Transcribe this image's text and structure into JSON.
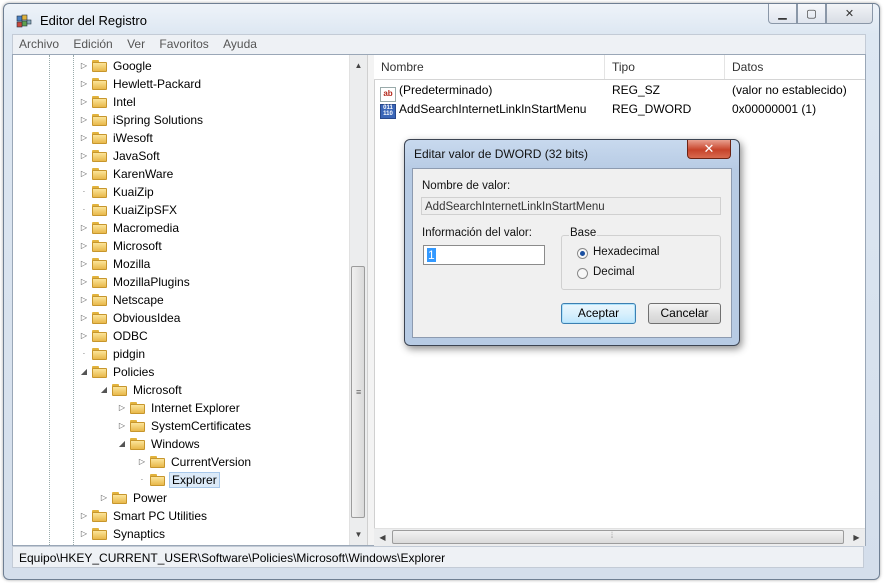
{
  "window": {
    "title": "Editor del Registro"
  },
  "menu": [
    "Archivo",
    "Edición",
    "Ver",
    "Favoritos",
    "Ayuda"
  ],
  "tree": {
    "items": [
      {
        "label": "Google",
        "depth": 0,
        "expander": "collapsed"
      },
      {
        "label": "Hewlett-Packard",
        "depth": 0,
        "expander": "collapsed"
      },
      {
        "label": "Intel",
        "depth": 0,
        "expander": "collapsed"
      },
      {
        "label": "iSpring Solutions",
        "depth": 0,
        "expander": "collapsed"
      },
      {
        "label": "iWesoft",
        "depth": 0,
        "expander": "collapsed"
      },
      {
        "label": "JavaSoft",
        "depth": 0,
        "expander": "collapsed"
      },
      {
        "label": "KarenWare",
        "depth": 0,
        "expander": "collapsed"
      },
      {
        "label": "KuaiZip",
        "depth": 0,
        "expander": "none"
      },
      {
        "label": "KuaiZipSFX",
        "depth": 0,
        "expander": "none"
      },
      {
        "label": "Macromedia",
        "depth": 0,
        "expander": "collapsed"
      },
      {
        "label": "Microsoft",
        "depth": 0,
        "expander": "collapsed"
      },
      {
        "label": "Mozilla",
        "depth": 0,
        "expander": "collapsed"
      },
      {
        "label": "MozillaPlugins",
        "depth": 0,
        "expander": "collapsed"
      },
      {
        "label": "Netscape",
        "depth": 0,
        "expander": "collapsed"
      },
      {
        "label": "ObviousIdea",
        "depth": 0,
        "expander": "collapsed"
      },
      {
        "label": "ODBC",
        "depth": 0,
        "expander": "collapsed"
      },
      {
        "label": "pidgin",
        "depth": 0,
        "expander": "none"
      },
      {
        "label": "Policies",
        "depth": 0,
        "expander": "expanded"
      },
      {
        "label": "Microsoft",
        "depth": 1,
        "expander": "expanded"
      },
      {
        "label": "Internet Explorer",
        "depth": 2,
        "expander": "collapsed"
      },
      {
        "label": "SystemCertificates",
        "depth": 2,
        "expander": "collapsed"
      },
      {
        "label": "Windows",
        "depth": 2,
        "expander": "expanded"
      },
      {
        "label": "CurrentVersion",
        "depth": 3,
        "expander": "collapsed"
      },
      {
        "label": "Explorer",
        "depth": 3,
        "expander": "none",
        "selected": true
      },
      {
        "label": "Power",
        "depth": 1,
        "expander": "collapsed"
      },
      {
        "label": "Smart PC Utilities",
        "depth": 0,
        "expander": "collapsed"
      },
      {
        "label": "Synaptics",
        "depth": 0,
        "expander": "collapsed"
      }
    ]
  },
  "list": {
    "columns": [
      "Nombre",
      "Tipo",
      "Datos"
    ],
    "rows": [
      {
        "icon": "string-value-icon",
        "name": "(Predeterminado)",
        "type": "REG_SZ",
        "data": "(valor no establecido)"
      },
      {
        "icon": "dword-value-icon",
        "name": "AddSearchInternetLinkInStartMenu",
        "type": "REG_DWORD",
        "data": "0x00000001 (1)"
      }
    ]
  },
  "dialog": {
    "title": "Editar valor de DWORD (32 bits)",
    "close_glyph": "✕",
    "value_name_label": "Nombre de valor:",
    "value_name": "AddSearchInternetLinkInStartMenu",
    "value_data_label": "Información del valor:",
    "value_data": "1",
    "base_label": "Base",
    "radio_hex": "Hexadecimal",
    "radio_dec": "Decimal",
    "ok": "Aceptar",
    "cancel": "Cancelar"
  },
  "status": {
    "path": "Equipo\\HKEY_CURRENT_USER\\Software\\Policies\\Microsoft\\Windows\\Explorer"
  },
  "icons": {
    "app": "registry-editor-icon",
    "folder": "folder-icon"
  }
}
